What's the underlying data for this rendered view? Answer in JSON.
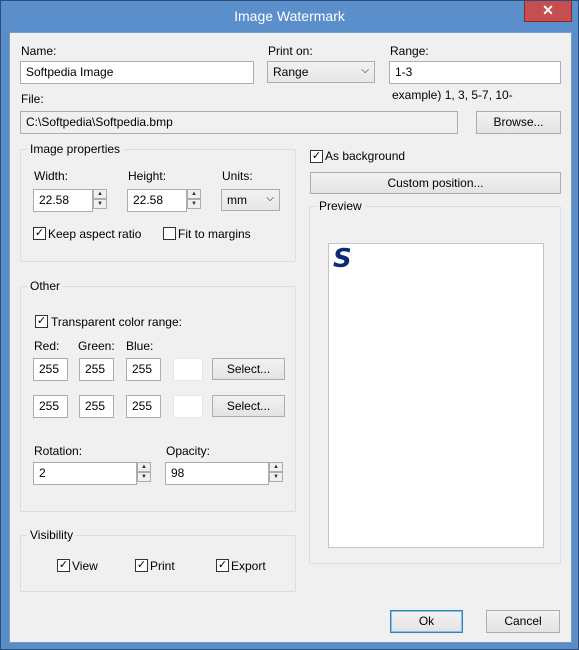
{
  "window": {
    "title": "Image Watermark",
    "close_glyph": "✕"
  },
  "name": {
    "label": "Name:",
    "value": "Softpedia Image"
  },
  "print_on": {
    "label": "Print on:",
    "value": "Range"
  },
  "range": {
    "label": "Range:",
    "value": "1-3",
    "example": "example) 1, 3, 5-7, 10-"
  },
  "file": {
    "label": "File:",
    "value": "C:\\Softpedia\\Softpedia.bmp",
    "browse_label": "Browse..."
  },
  "image_properties": {
    "title": "Image properties",
    "width_label": "Width:",
    "width_value": "22.58",
    "height_label": "Height:",
    "height_value": "22.58",
    "units_label": "Units:",
    "units_value": "mm",
    "keep_aspect_label": "Keep aspect ratio",
    "keep_aspect_checked": true,
    "fit_margins_label": "Fit to margins",
    "fit_margins_checked": false
  },
  "as_background": {
    "label": "As background",
    "checked": true
  },
  "custom_position_label": "Custom position...",
  "preview": {
    "title": "Preview",
    "glyph": "S"
  },
  "other": {
    "title": "Other",
    "transparent_label": "Transparent color range:",
    "transparent_checked": true,
    "red_label": "Red:",
    "green_label": "Green:",
    "blue_label": "Blue:",
    "row1": {
      "red": "255",
      "green": "255",
      "blue": "255",
      "select_label": "Select..."
    },
    "row2": {
      "red": "255",
      "green": "255",
      "blue": "255",
      "select_label": "Select..."
    },
    "rotation_label": "Rotation:",
    "rotation_value": "2",
    "opacity_label": "Opacity:",
    "opacity_value": "98"
  },
  "visibility": {
    "title": "Visibility",
    "view_label": "View",
    "view_checked": true,
    "print_label": "Print",
    "print_checked": true,
    "export_label": "Export",
    "export_checked": true
  },
  "buttons": {
    "ok": "Ok",
    "cancel": "Cancel"
  },
  "colors": {
    "titlebar": "#5b8fcb",
    "close": "#c74e4e",
    "watermark": "#0a2a7a"
  },
  "icons": {
    "close": "close-icon",
    "check": "check-icon",
    "spin_up": "spin-up-icon",
    "spin_down": "spin-down-icon",
    "dropdown": "chevron-down-icon"
  }
}
